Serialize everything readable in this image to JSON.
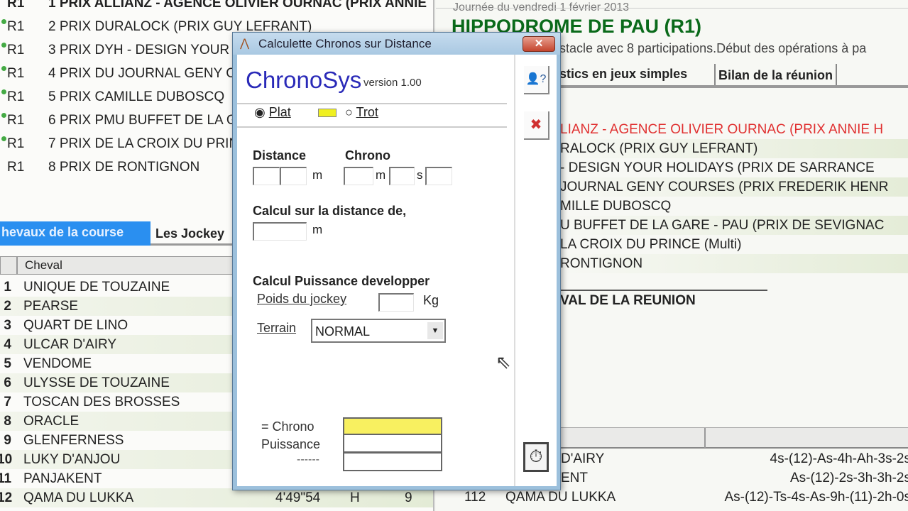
{
  "races": [
    {
      "reunion": "R1",
      "name": "1 PRIX ALLIANZ - AGENCE OLIVIER OURNAC (PRIX ANNIE"
    },
    {
      "reunion": "R1",
      "name": "2 PRIX DURALOCK (PRIX GUY LEFRANT)"
    },
    {
      "reunion": "R1",
      "name": "3 PRIX DYH - DESIGN YOUR HOLIDAYS"
    },
    {
      "reunion": "R1",
      "name": "4 PRIX DU JOURNAL GENY COURSES"
    },
    {
      "reunion": "R1",
      "name": "5 PRIX CAMILLE DUBOSCQ"
    },
    {
      "reunion": "R1",
      "name": "6 PRIX PMU BUFFET DE LA GARE"
    },
    {
      "reunion": "R1",
      "name": "7 PRIX DE LA CROIX DU PRINCE"
    },
    {
      "reunion": "R1",
      "name": "8 PRIX DE RONTIGNON"
    }
  ],
  "left_tabs": {
    "active": "hevaux de la course",
    "other": "Les Jockey"
  },
  "horse_table": {
    "col_cheval": "Cheval",
    "rows": [
      {
        "num": "1",
        "name": "UNIQUE DE TOUZAINE"
      },
      {
        "num": "2",
        "name": "PEARSE"
      },
      {
        "num": "3",
        "name": "QUART DE LINO"
      },
      {
        "num": "4",
        "name": "ULCAR D'AIRY"
      },
      {
        "num": "5",
        "name": "VENDOME"
      },
      {
        "num": "6",
        "name": "ULYSSE DE TOUZAINE"
      },
      {
        "num": "7",
        "name": "TOSCAN DES BROSSES"
      },
      {
        "num": "8",
        "name": "ORACLE"
      },
      {
        "num": "9",
        "name": "GLENFERNESS"
      },
      {
        "num": "10",
        "name": "LUKY D'ANJOU"
      },
      {
        "num": "11",
        "name": "PANJAKENT"
      },
      {
        "num": "12",
        "name": "QAMA DU LUKKA",
        "time": "4'49\"54",
        "sex": "H",
        "age": "9"
      }
    ]
  },
  "right": {
    "date": "Journée du vendredi 1 février 2013",
    "title": "HIPPODROME DE  PAU (R1)",
    "subtitle": "stacle avec 8 participations.Début des opérations à pa",
    "tabs": [
      "stics en jeux simples",
      "Bilan de la réunion"
    ],
    "lines": [
      "LIANZ - AGENCE OLIVIER OURNAC (PRIX ANNIE H",
      "RALOCK (PRIX GUY LEFRANT)",
      "- DESIGN YOUR HOLIDAYS (PRIX DE SARRANCE",
      "JOURNAL GENY COURSES (PRIX FREDERIK HENR",
      "MILLE DUBOSCQ",
      "U BUFFET DE LA GARE - PAU (PRIX DE SEVIGNAC",
      "LA CROIX DU PRINCE (Multi)",
      "RONTIGNON"
    ],
    "section": "VAL DE LA REUNION",
    "bottom_rows": [
      {
        "num": "",
        "name": "D'AIRY",
        "music": "4s-(12)-As-4h-Ah-3s-2s"
      },
      {
        "num": "",
        "name": "ENT",
        "music": "As-(12)-2s-3h-3h-2s"
      },
      {
        "num": "112",
        "name": "QAMA DU LUKKA",
        "music": "As-(12)-Ts-4s-As-9h-(11)-2h-0s"
      }
    ]
  },
  "dialog": {
    "title": "Calculette Chronos sur Distance",
    "close": "✕",
    "brand": "ChronoSys",
    "version": "version 1.00",
    "radio_plat": "Plat",
    "radio_trot": "Trot",
    "distance_label": "Distance",
    "chrono_label": "Chrono",
    "unit_m": "m",
    "unit_s": "s",
    "calc_distance_label": "Calcul sur la distance de,",
    "power_label": "Calcul Puissance developper",
    "weight_label": "Poids du jockey",
    "unit_kg": "Kg",
    "terrain_label": "Terrain",
    "terrain_value": "NORMAL",
    "result_chrono": "=  Chrono",
    "result_power": "Puissance",
    "result_other": "------",
    "accent": "#2a2ab8",
    "highlight": "#f8f060"
  }
}
